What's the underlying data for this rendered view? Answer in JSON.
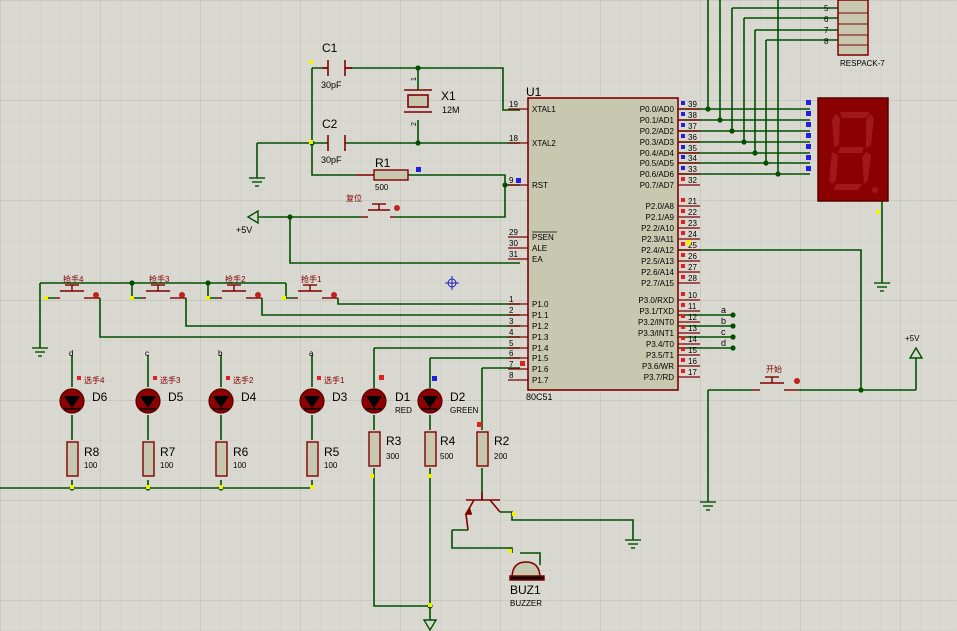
{
  "u1": {
    "ref": "U1",
    "part": "80C51",
    "left_pins": [
      {
        "num": "19",
        "name": "XTAL1"
      },
      {
        "num": "18",
        "name": "XTAL2"
      },
      {
        "num": "9",
        "name": "RST"
      },
      {
        "num": "29",
        "name": "PSEN"
      },
      {
        "num": "30",
        "name": "ALE"
      },
      {
        "num": "31",
        "name": "EA"
      },
      {
        "num": "1",
        "name": "P1.0"
      },
      {
        "num": "2",
        "name": "P1.1"
      },
      {
        "num": "3",
        "name": "P1.2"
      },
      {
        "num": "4",
        "name": "P1.3"
      },
      {
        "num": "5",
        "name": "P1.4"
      },
      {
        "num": "6",
        "name": "P1.5"
      },
      {
        "num": "7",
        "name": "P1.6"
      },
      {
        "num": "8",
        "name": "P1.7"
      }
    ],
    "right_pins": [
      {
        "num": "39",
        "name": "P0.0/AD0"
      },
      {
        "num": "38",
        "name": "P0.1/AD1"
      },
      {
        "num": "37",
        "name": "P0.2/AD2"
      },
      {
        "num": "36",
        "name": "P0.3/AD3"
      },
      {
        "num": "35",
        "name": "P0.4/AD4"
      },
      {
        "num": "34",
        "name": "P0.5/AD5"
      },
      {
        "num": "33",
        "name": "P0.6/AD6"
      },
      {
        "num": "32",
        "name": "P0.7/AD7"
      },
      {
        "num": "21",
        "name": "P2.0/A8"
      },
      {
        "num": "22",
        "name": "P2.1/A9"
      },
      {
        "num": "23",
        "name": "P2.2/A10"
      },
      {
        "num": "24",
        "name": "P2.3/A11"
      },
      {
        "num": "25",
        "name": "P2.4/A12"
      },
      {
        "num": "26",
        "name": "P2.5/A13"
      },
      {
        "num": "27",
        "name": "P2.6/A14"
      },
      {
        "num": "28",
        "name": "P2.7/A15"
      },
      {
        "num": "10",
        "name": "P3.0/RXD"
      },
      {
        "num": "11",
        "name": "P3.1/TXD"
      },
      {
        "num": "12",
        "name": "P3.2/INT0"
      },
      {
        "num": "13",
        "name": "P3.3/INT1"
      },
      {
        "num": "14",
        "name": "P3.4/T0"
      },
      {
        "num": "15",
        "name": "P3.5/T1"
      },
      {
        "num": "16",
        "name": "P3.6/WR"
      },
      {
        "num": "17",
        "name": "P3.7/RD"
      }
    ]
  },
  "components": {
    "c1": {
      "ref": "C1",
      "value": "30pF"
    },
    "c2": {
      "ref": "C2",
      "value": "30pF"
    },
    "x1": {
      "ref": "X1",
      "value": "12M",
      "pin1": "1",
      "pin2": "2"
    },
    "r1": {
      "ref": "R1",
      "value": "500"
    },
    "reset_label": "复位",
    "vcc_left": "+5V",
    "vcc_right": "+5V",
    "start_label": "开始",
    "respack": {
      "ref": "RESPACK-7",
      "pins": [
        "5",
        "6",
        "7",
        "8"
      ]
    },
    "buzzer": {
      "ref": "BUZ1",
      "value": "BUZZER"
    },
    "r2": {
      "ref": "R2",
      "value": "200"
    },
    "r3": {
      "ref": "R3",
      "value": "300"
    },
    "r4": {
      "ref": "R4",
      "value": "500"
    }
  },
  "buttons": [
    "抢手4",
    "抢手3",
    "抢手2",
    "抢手1"
  ],
  "leds": [
    {
      "ref": "D6",
      "label": "选手4",
      "node": "d",
      "res": "R8",
      "val": "100"
    },
    {
      "ref": "D5",
      "label": "选手3",
      "node": "c",
      "res": "R7",
      "val": "100"
    },
    {
      "ref": "D4",
      "label": "选手2",
      "node": "b",
      "res": "R6",
      "val": "100"
    },
    {
      "ref": "D3",
      "label": "选手1",
      "node": "a",
      "res": "R5",
      "val": "100"
    }
  ],
  "status_leds": [
    {
      "ref": "D1",
      "color_label": "RED"
    },
    {
      "ref": "D2",
      "color_label": "GREEN"
    }
  ],
  "port3_labels": [
    "a",
    "b",
    "c",
    "d"
  ],
  "colors": {
    "wire": "#005000",
    "component": "#800000",
    "chip_fill": "#c8c8b0",
    "display_bg": "#8b0000",
    "display_seg": "#a01818",
    "junction": "#005000",
    "pin_marker_red": "#e02020",
    "pin_marker_blue": "#2020e0",
    "pin_marker_yellow": "#f0f000"
  }
}
